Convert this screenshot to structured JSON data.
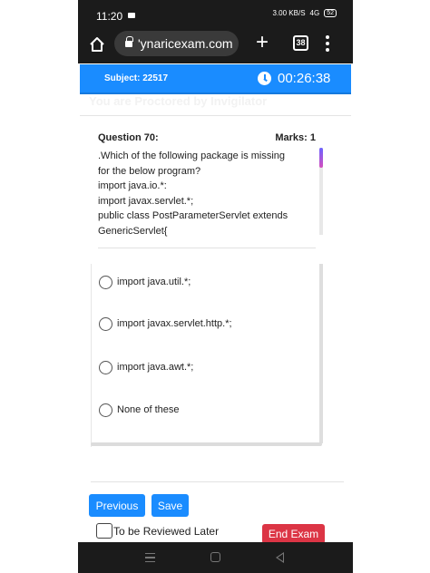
{
  "status_bar": {
    "time": "11:20",
    "network_speed": "3.00 KB/S",
    "signal": "4G",
    "battery": "52"
  },
  "browser": {
    "url": "ʹynaricexam.com",
    "tab_count": "38"
  },
  "exam": {
    "subject": "Subject: 22517",
    "timer": "00:26:38",
    "proctor_notice": "You are Proctored by Invigilator"
  },
  "question": {
    "title": "Question 70:",
    "marks": "Marks: 1",
    "text": ".Which of the following package is missing\nfor the below program?\nimport java.io.*:\nimport javax.servlet.*;\npublic class PostParameterServlet extends\nGenericServlet{"
  },
  "options": [
    {
      "label": "import java.util.*;"
    },
    {
      "label": "import javax.servlet.http.*;"
    },
    {
      "label": "import java.awt.*;"
    },
    {
      "label": "None of these"
    }
  ],
  "buttons": {
    "previous": "Previous",
    "save": "Save",
    "review_label": "To be Reviewed Later",
    "end_exam": "End Exam"
  },
  "colors": {
    "primary": "#1a8cff",
    "danger": "#dc3545",
    "system_bar": "#1b1b1b"
  }
}
